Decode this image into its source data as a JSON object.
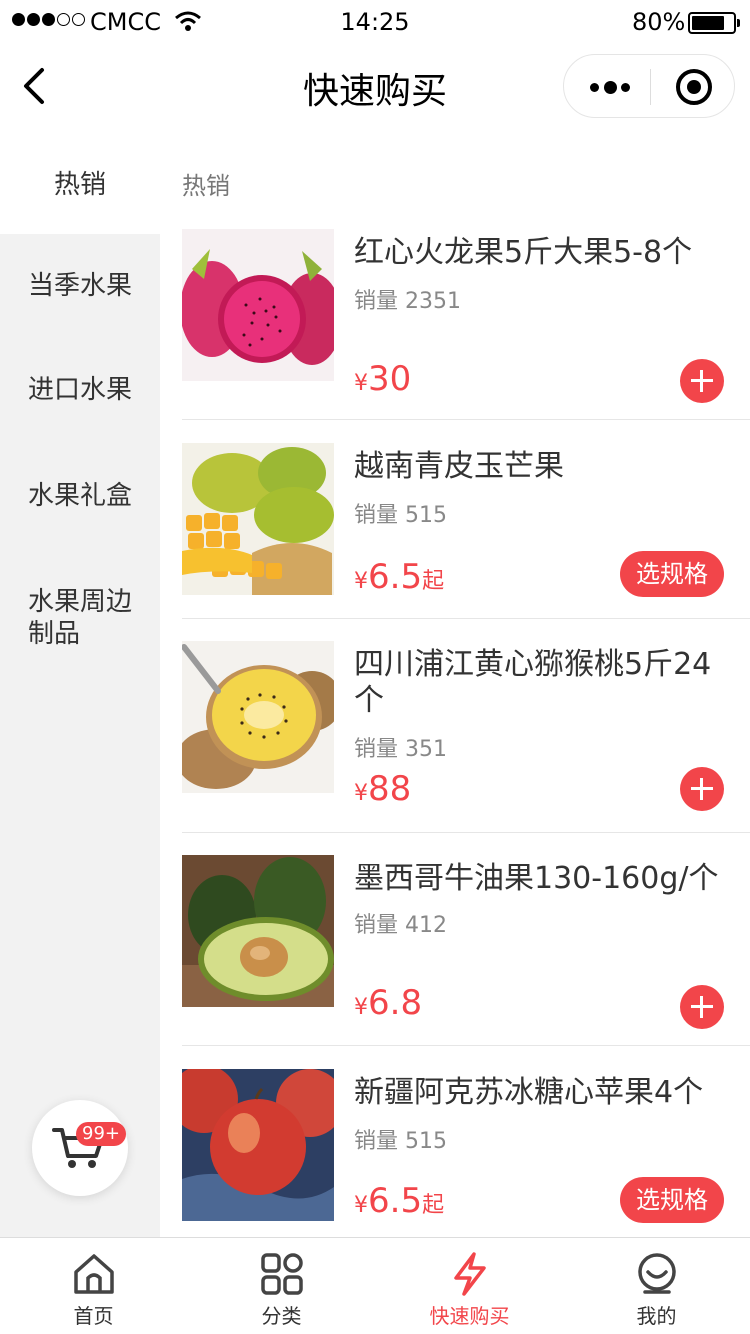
{
  "status_bar": {
    "carrier": "CMCC",
    "time": "14:25",
    "battery": "80%"
  },
  "nav": {
    "title": "快速购买"
  },
  "sidebar": {
    "header": "热销",
    "items": [
      {
        "label": "当季水果"
      },
      {
        "label": "进口水果"
      },
      {
        "label": "水果礼盒"
      },
      {
        "label": "水果周边制品"
      }
    ]
  },
  "section": {
    "title": "热销"
  },
  "sales_prefix": "销量",
  "currency": "¥",
  "products": [
    {
      "name": "红心火龙果5斤大果5-8个",
      "sales": "2351",
      "price": "30",
      "price_suffix": "",
      "action": "add"
    },
    {
      "name": "越南青皮玉芒果",
      "sales": "515",
      "price": "6.5",
      "price_suffix": "起",
      "action": "选规格"
    },
    {
      "name": "四川浦江黄心猕猴桃5斤24个",
      "sales": "351",
      "price": "88",
      "price_suffix": "",
      "action": "add"
    },
    {
      "name": "墨西哥牛油果130-160g/个",
      "sales": "412",
      "price": "6.8",
      "price_suffix": "",
      "action": "add"
    },
    {
      "name": "新疆阿克苏冰糖心苹果4个",
      "sales": "515",
      "price": "6.5",
      "price_suffix": "起",
      "action": "选规格"
    }
  ],
  "cart": {
    "badge": "99+"
  },
  "tabs": [
    {
      "label": "首页",
      "icon": "home-icon"
    },
    {
      "label": "分类",
      "icon": "grid-icon"
    },
    {
      "label": "快速购买",
      "icon": "lightning-icon",
      "active": true
    },
    {
      "label": "我的",
      "icon": "user-icon"
    }
  ],
  "colors": {
    "accent": "#f2454a",
    "sidebar_bg": "#f2f2f2"
  }
}
